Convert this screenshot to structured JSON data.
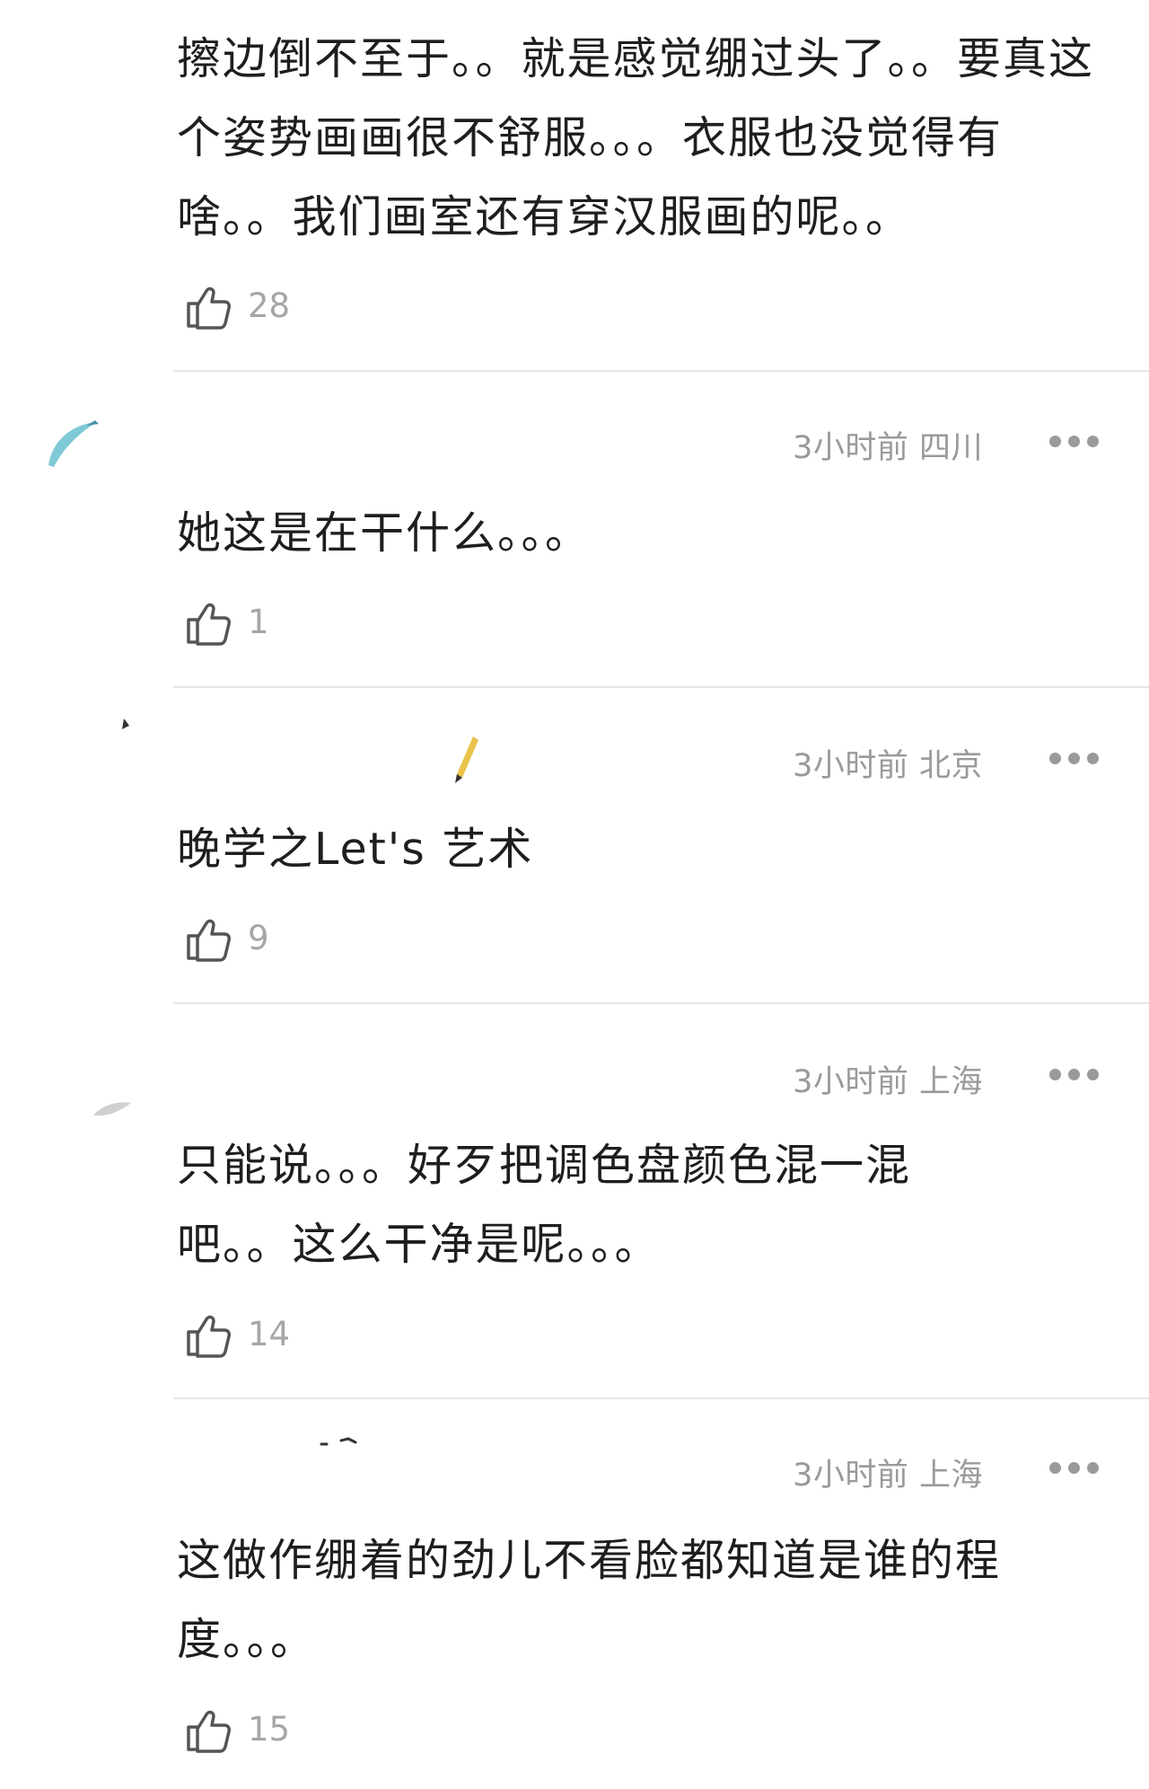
{
  "comments": [
    {
      "text": "擦边倒不至于。。就是感觉绷过头了。。要真这个姿势画画很不舒服。。。衣服也没觉得有啥。。我们画室还有穿汉服画的呢。。",
      "likes": "28"
    },
    {
      "time": "3小时前",
      "location": "四川",
      "text": "她这是在干什么。。。",
      "likes": "1"
    },
    {
      "time": "3小时前",
      "location": "北京",
      "text": "晚学之Let's 艺术",
      "likes": "9"
    },
    {
      "time": "3小时前",
      "location": "上海",
      "text": "只能说。。。好歹把调色盘颜色混一混吧。。这么干净是呢。。。",
      "likes": "14"
    },
    {
      "time": "3小时前",
      "location": "上海",
      "text": "这做作绷着的劲儿不看脸都知道是谁的程度。。。",
      "likes": "15"
    }
  ],
  "icons": {
    "like": "thumbs-up-icon",
    "more": "more-dots-icon"
  },
  "colors": {
    "meta_text": "#9a9a9a",
    "like_text": "#a6a6a6",
    "divider": "#e6e6e6",
    "body_text": "#1e1e1e"
  }
}
